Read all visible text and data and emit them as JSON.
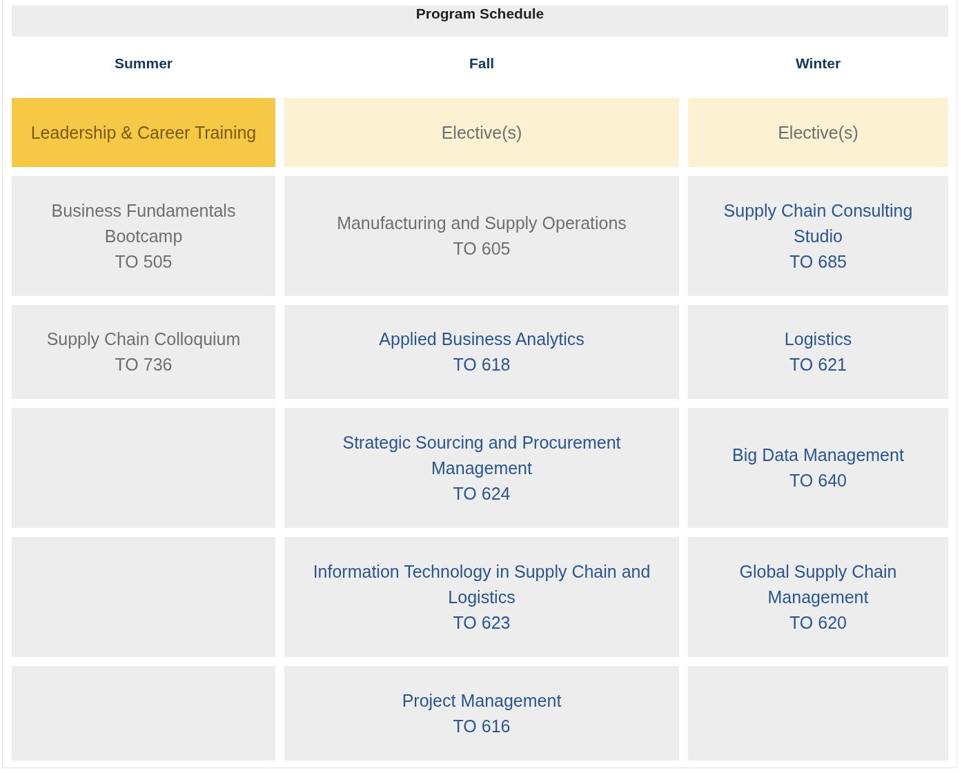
{
  "title": "Program Schedule",
  "columns": [
    "Summer",
    "Fall",
    "Winter"
  ],
  "rows": [
    [
      {
        "kind": "highlight",
        "title": "Leadership & Career Training"
      },
      {
        "kind": "elective",
        "title": "Elective(s)"
      },
      {
        "kind": "elective",
        "title": "Elective(s)"
      }
    ],
    [
      {
        "kind": "text",
        "title": "Business Fundamentals Bootcamp",
        "code": "TO 505"
      },
      {
        "kind": "text",
        "title": "Manufacturing and Supply Operations",
        "code": "TO 605"
      },
      {
        "kind": "link",
        "title": "Supply Chain Consulting Studio",
        "code": "TO 685"
      }
    ],
    [
      {
        "kind": "text",
        "title": "Supply Chain Colloquium",
        "code": "TO 736"
      },
      {
        "kind": "link",
        "title": "Applied Business Analytics",
        "code": "TO 618"
      },
      {
        "kind": "link",
        "title": "Logistics",
        "code": "TO 621"
      }
    ],
    [
      {
        "kind": "empty"
      },
      {
        "kind": "link",
        "title": "Strategic Sourcing and Procurement Management",
        "code": "TO 624"
      },
      {
        "kind": "link",
        "title": "Big Data Management",
        "code": "TO 640"
      }
    ],
    [
      {
        "kind": "empty"
      },
      {
        "kind": "link",
        "title": "Information Technology in Supply Chain and Logistics",
        "code": "TO 623"
      },
      {
        "kind": "link",
        "title": "Global Supply Chain Management",
        "code": "TO 620"
      }
    ],
    [
      {
        "kind": "empty"
      },
      {
        "kind": "link",
        "title": "Project Management",
        "code": "TO 616"
      },
      {
        "kind": "empty"
      }
    ]
  ]
}
